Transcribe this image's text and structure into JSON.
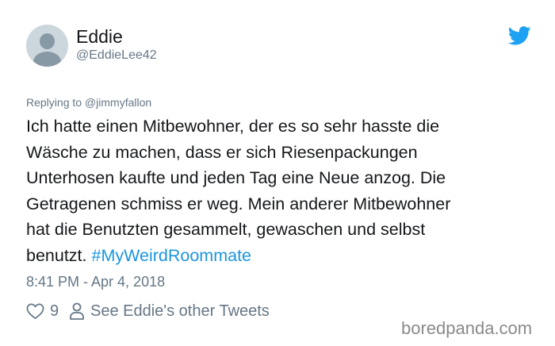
{
  "user": {
    "display_name": "Eddie",
    "handle": "@EddieLee42"
  },
  "reply": {
    "text": "Replying to @jimmyfallon"
  },
  "tweet": {
    "lines": [
      "Ich hatte einen Mitbewohner, der es so sehr hasste die",
      "Wäsche zu machen, dass er sich Riesenpackungen",
      "Unterhosen kaufte und jeden Tag eine Neue anzog. Die",
      "Getragenen schmiss er weg. Mein anderer Mitbewohner",
      "hat die Benutzten gesammelt, gewaschen und selbst"
    ],
    "last_line_text": "benutzt.",
    "hashtag": "#MyWeirdRoommate",
    "timestamp": "8:41 PM - Apr 4, 2018"
  },
  "actions": {
    "like_count": "9",
    "profile_link": "See Eddie's other Tweets",
    "like_icon": "heart-outline",
    "profile_icon": "person-outline"
  },
  "brand": {
    "icon": "twitter-bird",
    "color": "#1da1f2"
  },
  "colors": {
    "text": "#14171a",
    "secondary": "#657786",
    "link": "#1b95e0",
    "avatar_bg": "#ccd6dd",
    "avatar_fg": "#8899a6"
  },
  "watermark": "boredpanda.com"
}
